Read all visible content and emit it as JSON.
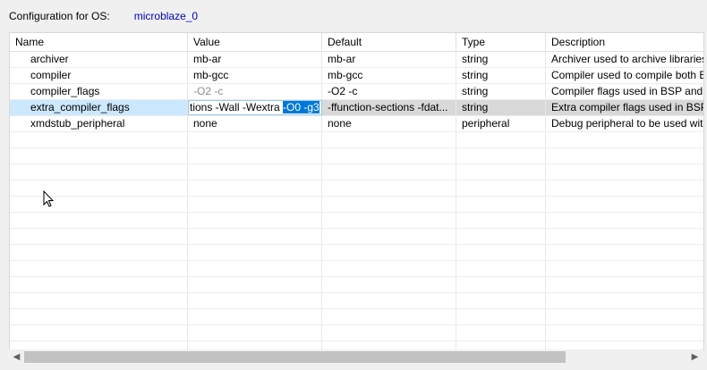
{
  "config": {
    "label": "Configuration for OS:",
    "value": "microblaze_0"
  },
  "columns": [
    "Name",
    "Value",
    "Default",
    "Type",
    "Description"
  ],
  "rows": [
    {
      "name": "archiver",
      "value": "mb-ar",
      "default": "mb-ar",
      "type": "string",
      "description": "Archiver used to archive libraries"
    },
    {
      "name": "compiler",
      "value": "mb-gcc",
      "default": "mb-gcc",
      "type": "string",
      "description": "Compiler used to compile both BSP"
    },
    {
      "name": "compiler_flags",
      "value": "-O2 -c",
      "default": "-O2 -c",
      "type": "string",
      "description": "Compiler flags used in BSP and lib"
    },
    {
      "name": "extra_compiler_flags",
      "value_prefix": "tions -Wall -Wextra ",
      "value_selected": "-O0 -g3",
      "default": "-ffunction-sections -fdat...",
      "type": "string",
      "description": "Extra compiler flags used in BSP an"
    },
    {
      "name": "xmdstub_peripheral",
      "value": "none",
      "default": "none",
      "type": "peripheral",
      "description": "Debug peripheral to be used with x"
    }
  ],
  "icons": {
    "scroll_left": "chevron-left-icon",
    "scroll_right": "chevron-right-icon",
    "cursor": "mouse-pointer-icon"
  }
}
